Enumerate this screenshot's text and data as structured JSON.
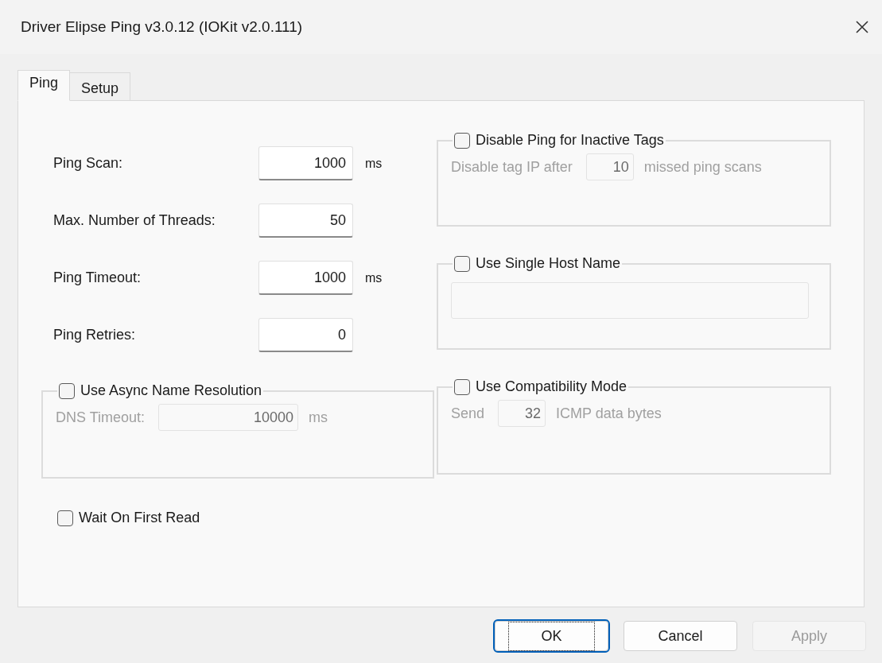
{
  "window": {
    "title": "Driver Elipse Ping v3.0.12 (IOKit v2.0.111)"
  },
  "tabs": [
    {
      "label": "Ping",
      "selected": true
    },
    {
      "label": "Setup",
      "selected": false
    }
  ],
  "fields": [
    {
      "label": "Ping Scan:",
      "value": "1000",
      "unit": "ms"
    },
    {
      "label": "Max. Number of Threads:",
      "value": "50"
    },
    {
      "label": "Ping Timeout:",
      "value": "1000",
      "unit": "ms"
    },
    {
      "label": "Ping Retries:",
      "value": "0"
    }
  ],
  "left_groups": [
    {
      "label": "Use Async Name Resolution",
      "checked": false,
      "disabled": true,
      "kind": "inline_field",
      "text": "DNS Timeout:",
      "value": "10000",
      "unit": "ms"
    }
  ],
  "wait_on_first_read": {
    "label": "Wait On First Read",
    "checked": false
  },
  "right_groups": [
    {
      "label": "Disable Ping for Inactive Tags",
      "checked": false,
      "disabled": true,
      "kind": "inline_field",
      "text": "Disable tag IP after",
      "value": "10",
      "unit": "missed ping scans"
    },
    {
      "label": "Use Single Host Name",
      "checked": false,
      "disabled": true,
      "kind": "text_field"
    },
    {
      "label": "Use Compatibility Mode",
      "checked": false,
      "disabled": true,
      "kind": "inline_field",
      "text": "Send",
      "value": "32",
      "unit": "ICMP data bytes"
    }
  ],
  "buttons": [
    {
      "label": "OK",
      "focused": true,
      "disabled": false
    },
    {
      "label": "Cancel",
      "focused": false,
      "disabled": false
    },
    {
      "label": "Apply",
      "focused": false,
      "disabled": true
    }
  ]
}
